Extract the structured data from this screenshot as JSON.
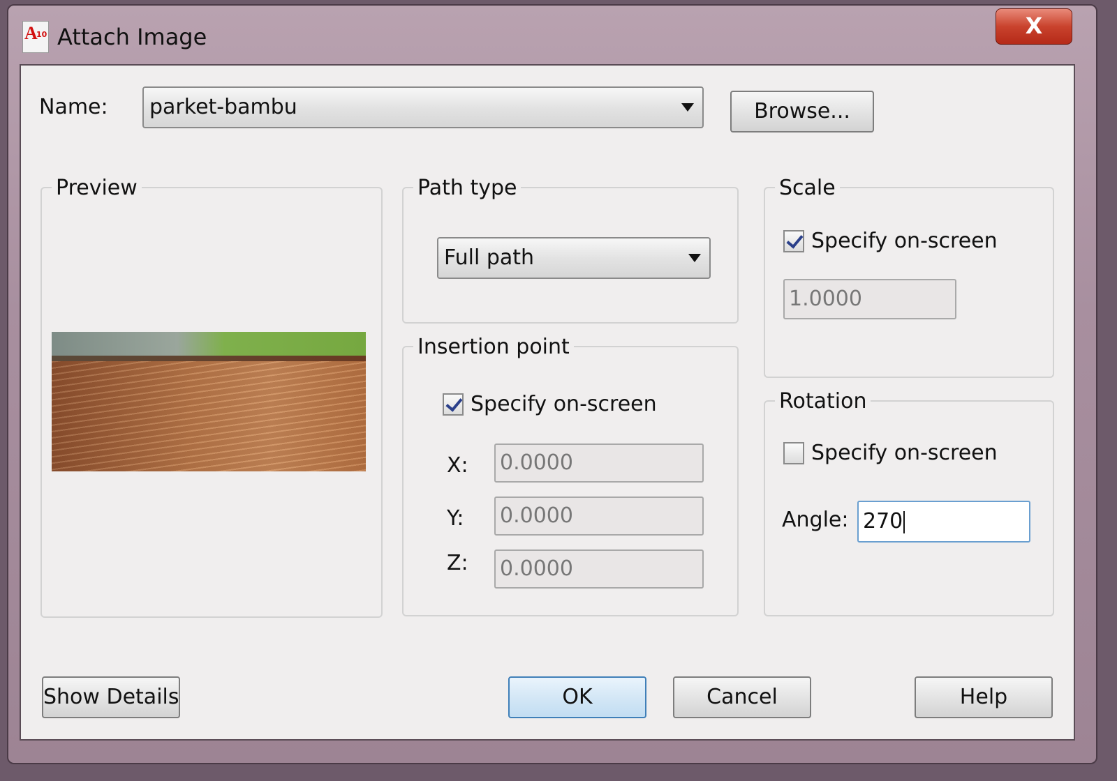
{
  "window": {
    "title": "Attach Image",
    "close_label": "X",
    "app_icon": "autocad-logo-icon"
  },
  "name_row": {
    "label": "Name:",
    "value": "parket-bambu",
    "browse_label": "Browse..."
  },
  "preview": {
    "title": "Preview"
  },
  "path_type": {
    "title": "Path type",
    "value": "Full path"
  },
  "insertion_point": {
    "title": "Insertion point",
    "specify_label": "Specify on-screen",
    "specify_checked": true,
    "x_label": "X:",
    "x_value": "0.0000",
    "y_label": "Y:",
    "y_value": "0.0000",
    "z_label": "Z:",
    "z_value": "0.0000"
  },
  "scale": {
    "title": "Scale",
    "specify_label": "Specify on-screen",
    "specify_checked": true,
    "value": "1.0000"
  },
  "rotation": {
    "title": "Rotation",
    "specify_label": "Specify on-screen",
    "specify_checked": false,
    "angle_label": "Angle:",
    "angle_value": "270"
  },
  "buttons": {
    "show_details": "Show Details",
    "ok": "OK",
    "cancel": "Cancel",
    "help": "Help"
  }
}
